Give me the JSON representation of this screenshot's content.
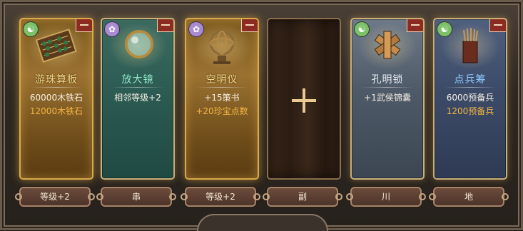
{
  "cards": [
    {
      "name": "游珠算板",
      "line1": "60000木铁石",
      "line2": "12000木铁石",
      "button": "等级+2",
      "grade_icon": "green-grade-icon"
    },
    {
      "name": "放大镜",
      "line1": "相邻等级+2",
      "line2": "",
      "button": "串",
      "grade_icon": "purple-grade-icon"
    },
    {
      "name": "空明仪",
      "line1": "+15策书",
      "line2": "+20珍宝点数",
      "button": "等级+2",
      "grade_icon": "purple-grade-icon"
    },
    {
      "name": "",
      "line1": "",
      "line2": "",
      "button": "副",
      "grade_icon": ""
    },
    {
      "name": "孔明锁",
      "line1": "+1武侯锦囊",
      "line2": "",
      "button": "川",
      "grade_icon": "green-grade-icon"
    },
    {
      "name": "点兵筹",
      "line1": "6000预备兵",
      "line2": "1200预备兵",
      "button": "地",
      "grade_icon": "green-grade-icon"
    }
  ],
  "colors": {
    "gold_value": "#f3b442",
    "white_value": "#f5eee2",
    "tag_red": "#8c2b22"
  }
}
